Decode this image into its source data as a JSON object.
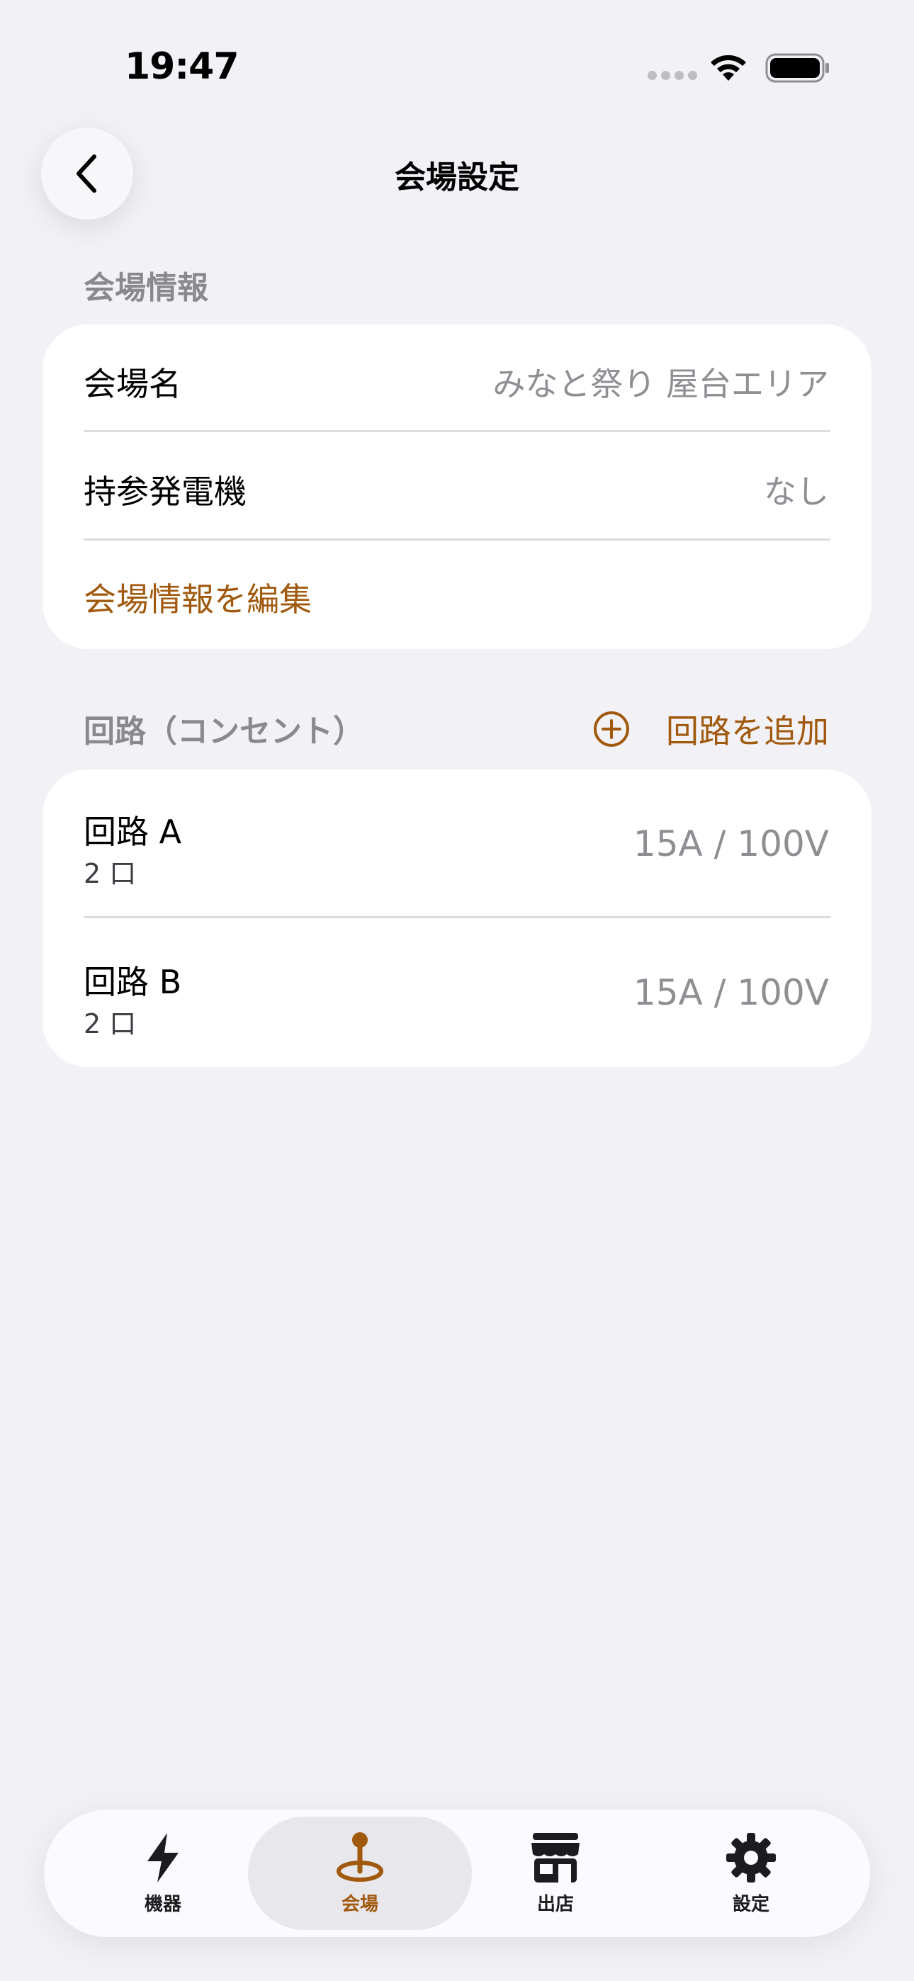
{
  "status_bar": {
    "time": "19:47"
  },
  "nav": {
    "title": "会場設定"
  },
  "venue_section": {
    "header": "会場情報",
    "rows": [
      {
        "label": "会場名",
        "value": "みなと祭り 屋台エリア"
      },
      {
        "label": "持参発電機",
        "value": "なし"
      }
    ],
    "edit_label": "会場情報を編集"
  },
  "circuit_section": {
    "header": "回路（コンセント）",
    "add_label": "回路を追加",
    "circuits": [
      {
        "name": "回路 A",
        "outlets": "2 口",
        "spec": "15A / 100V"
      },
      {
        "name": "回路 B",
        "outlets": "2 口",
        "spec": "15A / 100V"
      }
    ]
  },
  "tab_bar": {
    "tabs": [
      {
        "label": "機器",
        "icon": "bolt-icon",
        "active": false
      },
      {
        "label": "会場",
        "icon": "map-pin-icon",
        "active": true
      },
      {
        "label": "出店",
        "icon": "storefront-icon",
        "active": false
      },
      {
        "label": "設定",
        "icon": "gear-icon",
        "active": false
      }
    ]
  },
  "colors": {
    "accent": "#a0590d",
    "background": "#f2f1f6",
    "card": "#ffffff",
    "secondary_text": "#8e8e93"
  }
}
